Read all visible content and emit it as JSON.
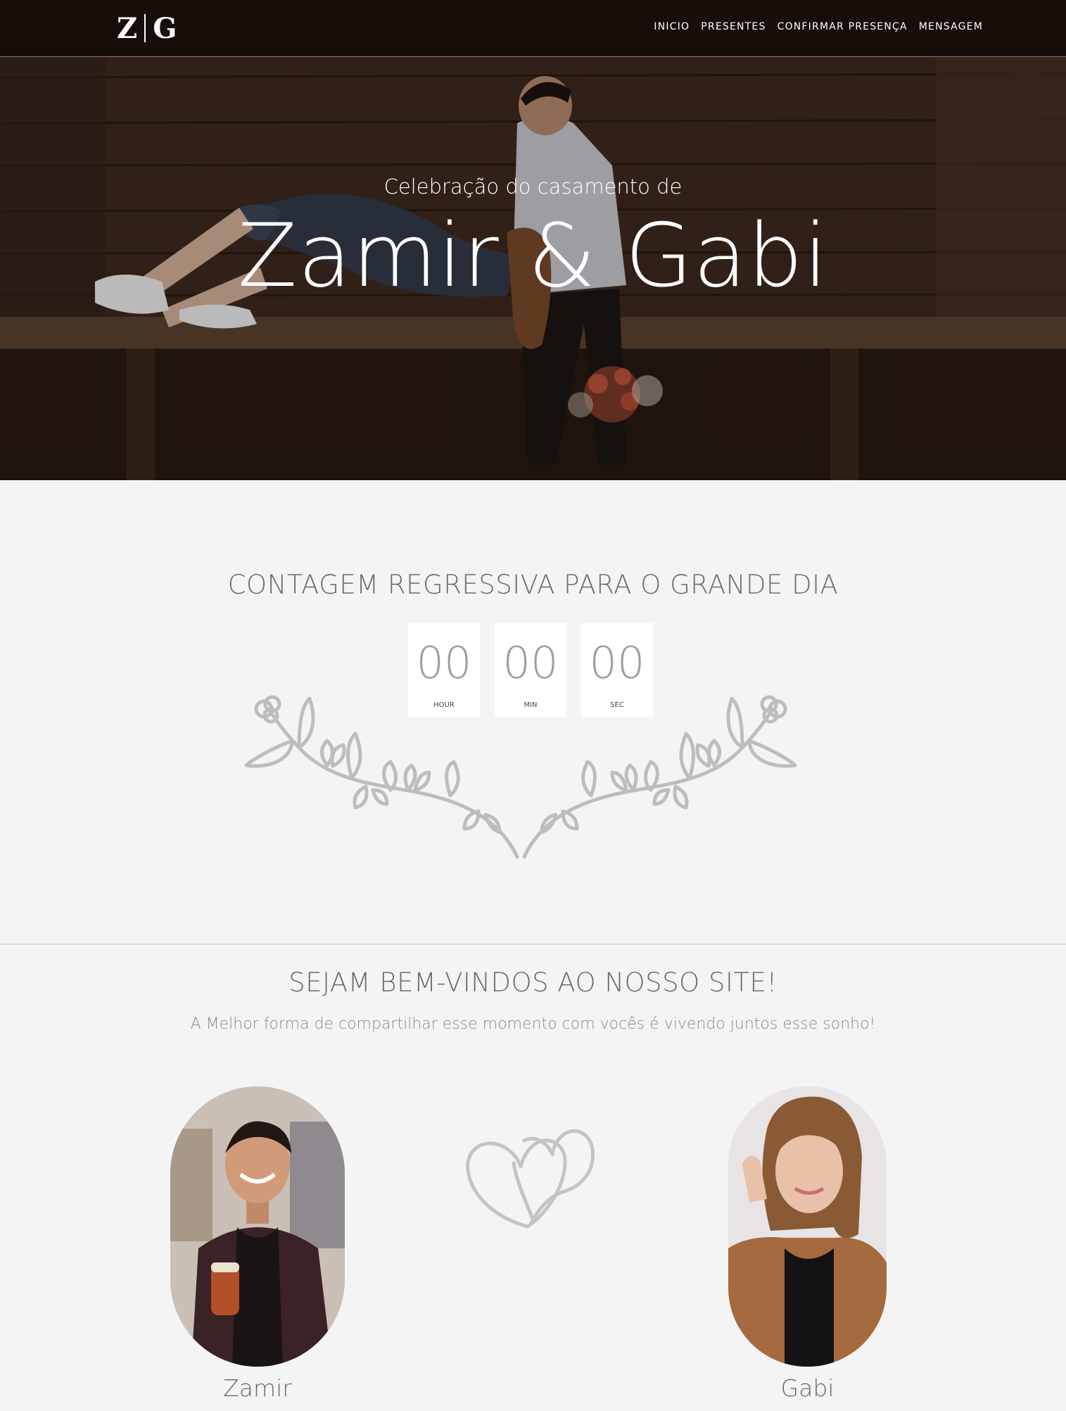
{
  "logo": {
    "left_letter": "Z",
    "right_letter": "G"
  },
  "nav": {
    "items": [
      "INICIO",
      "PRESENTES",
      "CONFIRMAR PRESENÇA",
      "MENSAGEM"
    ]
  },
  "hero": {
    "subtitle": "Celebração do casamento de",
    "title": "Zamir & Gabi"
  },
  "countdown": {
    "title": "CONTAGEM REGRESSIVA PARA O GRANDE DIA",
    "units": [
      {
        "value": "00",
        "label": "HOUR"
      },
      {
        "value": "00",
        "label": "MIN"
      },
      {
        "value": "00",
        "label": "SEC"
      }
    ]
  },
  "welcome": {
    "title": "SEJAM BEM-VINDOS AO NOSSO SITE!",
    "subtitle": "A Melhor forma de compartilhar esse momento com vocês é vivendo juntos esse sonho!"
  },
  "couple": {
    "groom": {
      "name": "Zamir"
    },
    "bride": {
      "name": "Gabi"
    }
  },
  "colors": {
    "page_bg": "#f4f4f4",
    "heading_text": "#6b6b6b",
    "ornament": "#bdbdbd",
    "nav_text": "#ffffff"
  },
  "icons": [
    "floral-wreath-icon",
    "two-hearts-icon"
  ]
}
